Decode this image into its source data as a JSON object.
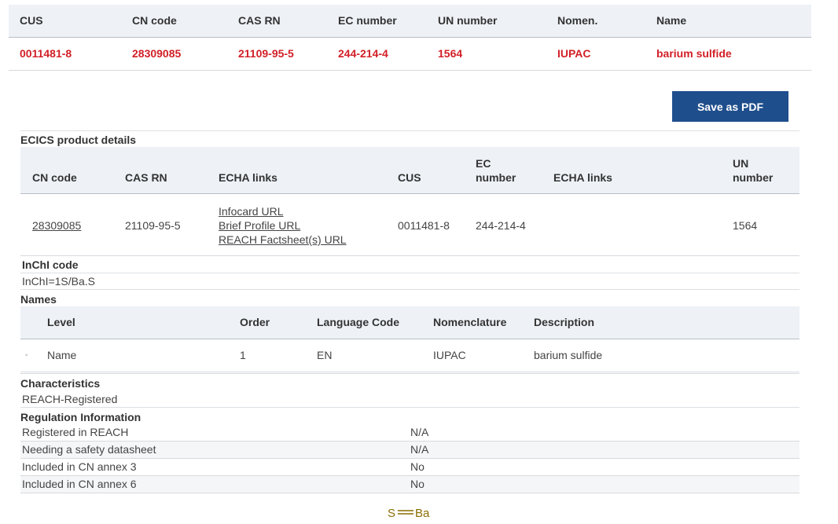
{
  "summary": {
    "headers": [
      "CUS",
      "CN code",
      "CAS RN",
      "EC number",
      "UN number",
      "Nomen.",
      "Name"
    ],
    "values": [
      "0011481-8",
      "28309085",
      "21109-95-5",
      "244-214-4",
      "1564",
      "IUPAC",
      "barium sulfide"
    ]
  },
  "actions": {
    "save_pdf": "Save as PDF"
  },
  "details": {
    "title": "ECICS product details",
    "headers": {
      "cn_code": "CN code",
      "cas_rn": "CAS RN",
      "echa_links": "ECHA links",
      "cus": "CUS",
      "ec_number_1": "EC",
      "ec_number_2": "number",
      "echa_links_2": "ECHA links",
      "un_number_1": "UN",
      "un_number_2": "number"
    },
    "row": {
      "cn_code": "28309085",
      "cas_rn": "21109-95-5",
      "links": [
        "Infocard URL",
        "Brief Profile URL",
        "REACH Factsheet(s) URL"
      ],
      "cus": "0011481-8",
      "ec_number": "244-214-4",
      "un_number": "1564"
    }
  },
  "inchi": {
    "title": "InChI code",
    "value": "InChI=1S/Ba.S"
  },
  "names": {
    "title": "Names",
    "headers": {
      "level": "Level",
      "order": "Order",
      "language": "Language Code",
      "nomenclature": "Nomenclature",
      "description": "Description"
    },
    "row": {
      "bullet": "◦",
      "level": "Name",
      "order": "1",
      "language": "EN",
      "nomenclature": "IUPAC",
      "description": "barium sulfide"
    }
  },
  "characteristics": {
    "title": "Characteristics",
    "value": "REACH-Registered"
  },
  "regulation": {
    "title": "Regulation Information",
    "rows": [
      {
        "label": "Registered in REACH",
        "value": "N/A"
      },
      {
        "label": "Needing a safety datasheet",
        "value": "N/A"
      },
      {
        "label": "Included in CN annex 3",
        "value": "No"
      },
      {
        "label": "Included in CN annex 6",
        "value": "No"
      }
    ]
  },
  "structure": {
    "left_atom": "S",
    "right_atom": "Ba",
    "color": "#8a6d00"
  }
}
